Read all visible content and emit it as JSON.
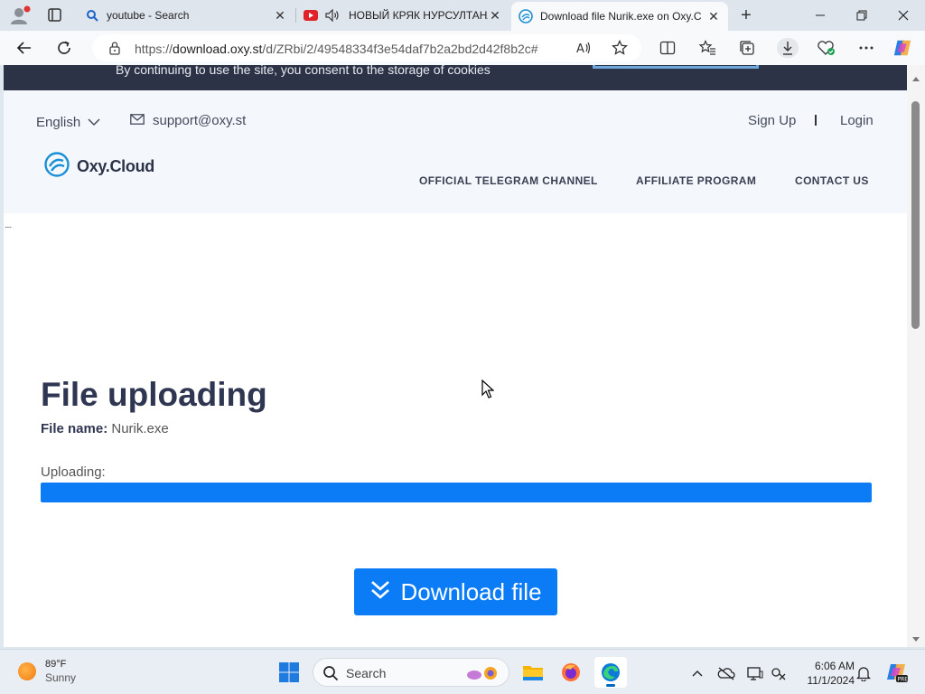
{
  "browser": {
    "tabs": [
      {
        "title": "youtube - Search",
        "icon": "search-icon",
        "active": false
      },
      {
        "title": "НОВЫЙ КРЯК НУРСУЛТАНА",
        "icon": "youtube-icon",
        "active": false
      },
      {
        "title": "Download file Nurik.exe on Oxy.C",
        "icon": "oxy-cloud-icon",
        "active": true
      }
    ],
    "address_bar": {
      "url_scheme": "https://",
      "url_host": "download.oxy.st",
      "url_path": "/d/ZRbi/2/49548334f3e54daf7b2a2bd2d42f8b2c#"
    }
  },
  "page": {
    "cookie_notice": "By continuing to use the site, you consent to the storage of cookies",
    "header": {
      "language": "English",
      "support_email": "support@oxy.st",
      "sign_up": "Sign Up",
      "divider": "I",
      "login": "Login",
      "logo_text": "Oxy.Cloud",
      "menu": [
        "OFFICIAL TELEGRAM CHANNEL",
        "AFFILIATE PROGRAM",
        "CONTACT US"
      ]
    },
    "ellipsis": "....",
    "title": "File uploading",
    "file_name_label": "File name:",
    "file_name": "Nurik.exe",
    "uploading_label": "Uploading:",
    "upload_progress_percent": 100,
    "download_button": "Download file",
    "accent_color": "#0b7cf6",
    "title_color": "#2f3651"
  },
  "taskbar": {
    "weather_temp": "89°F",
    "weather_condition": "Sunny",
    "search_label": "Search",
    "time": "6:06 AM",
    "date": "11/1/2024"
  }
}
